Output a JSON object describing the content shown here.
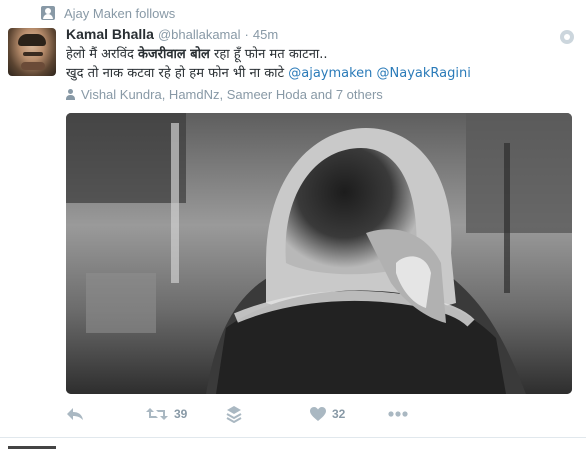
{
  "context": {
    "text": "Ajay Maken follows",
    "icon": "follow-user-icon"
  },
  "tweet": {
    "author": {
      "name": "Kamal Bhalla",
      "handle": "@bhallakamal"
    },
    "separator": "·",
    "time": "45m",
    "text": {
      "line1_before": "हेलो मैं अरविंद ",
      "line1_bold": "केजरीवाल बोल",
      "line1_after": " रहा हूँ फोन मत काटना..",
      "line2_text": "खुद तो नाक कटवा रहे हो हम फोन भी ना काटे ",
      "mention1": "@ajaymaken",
      "mention2": "@NayakRagini"
    },
    "social_context": "Vishal Kundra, HamdNz, Sameer Hoda and 7 others",
    "actions": {
      "reply_icon": "reply-icon",
      "retweet_icon": "retweet-icon",
      "retweet_count": "39",
      "layers_icon": "layers-icon",
      "like_icon": "heart-icon",
      "like_count": "32",
      "more_icon": "more-dots-icon"
    }
  },
  "colors": {
    "link": "#2b7bb9",
    "muted": "#8899a6",
    "text": "#292f33"
  }
}
